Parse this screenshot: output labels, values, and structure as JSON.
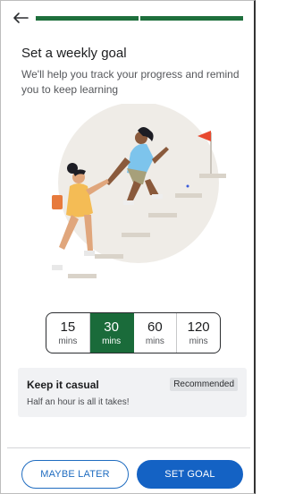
{
  "header": {
    "back_icon": "arrow-left-icon",
    "progress_segments": 2,
    "progress_complete": 2,
    "accent": "#1e6f3c"
  },
  "title": "Set a weekly goal",
  "subtitle": "We'll help you track your progress and remind you to keep learning",
  "illustration": {
    "description_icon": "climbing-stairs-illustration",
    "flag_color": "#e8492f"
  },
  "options": [
    {
      "value": "15",
      "unit": "mins",
      "selected": false
    },
    {
      "value": "30",
      "unit": "mins",
      "selected": true
    },
    {
      "value": "60",
      "unit": "mins",
      "selected": false
    },
    {
      "value": "120",
      "unit": "mins",
      "selected": false
    }
  ],
  "card": {
    "title": "Keep it casual",
    "badge": "Recommended",
    "description": "Half an hour is all it takes!"
  },
  "buttons": {
    "later": "MAYBE LATER",
    "set_goal": "SET GOAL",
    "primary_color": "#1462c4"
  }
}
